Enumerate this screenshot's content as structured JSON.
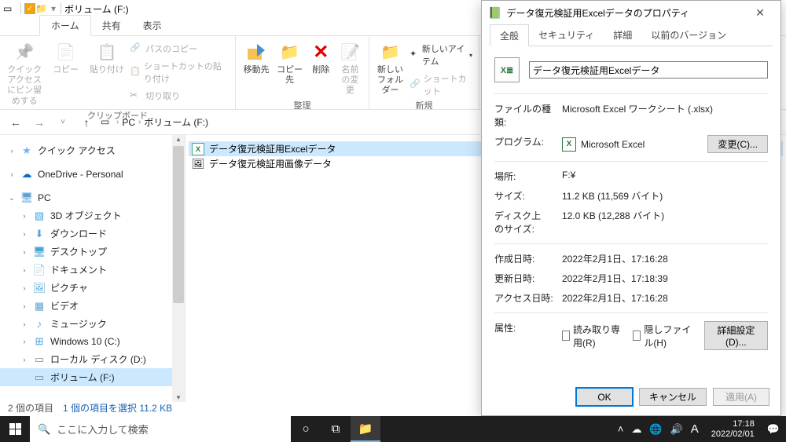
{
  "titlebar": {
    "title": "ボリューム (F:)"
  },
  "ribbon_tabs": {
    "home": "ホーム",
    "share": "共有",
    "view": "表示"
  },
  "ribbon": {
    "clipboard": {
      "pin": "クイック アクセス\nにピン留めする",
      "copy": "コピー",
      "paste": "貼り付け",
      "cut": "切り取り",
      "path": "パスのコピー",
      "shortcut": "ショートカットの貼り付け",
      "group": "クリップボード"
    },
    "organize": {
      "move": "移動先",
      "copyto": "コピー先",
      "delete": "削除",
      "rename": "名前\nの変更",
      "group": "整理"
    },
    "new": {
      "folder": "新しい\nフォルダー",
      "item": "新しいアイテム",
      "shortcut": "ショートカット",
      "group": "新規"
    }
  },
  "address": {
    "pc": "PC",
    "vol": "ボリューム (F:)"
  },
  "nav": {
    "quick": "クイック アクセス",
    "onedrive": "OneDrive - Personal",
    "pc": "PC",
    "objects3d": "3D オブジェクト",
    "downloads": "ダウンロード",
    "desktop": "デスクトップ",
    "documents": "ドキュメント",
    "pictures": "ピクチャ",
    "videos": "ビデオ",
    "music": "ミュージック",
    "cdrive": "Windows 10 (C:)",
    "ddrive": "ローカル ディスク (D:)",
    "fdrive": "ボリューム (F:)"
  },
  "files": {
    "f1": "データ復元検証用Excelデータ",
    "f2": "データ復元検証用画像データ"
  },
  "status": {
    "count": "2 個の項目",
    "sel": "1 個の項目を選択 11.2 KB"
  },
  "props": {
    "title": "データ復元検証用Excelデータのプロパティ",
    "tabs": {
      "general": "全般",
      "security": "セキュリティ",
      "details": "詳細",
      "prev": "以前のバージョン"
    },
    "filename": "データ復元検証用Excelデータ",
    "labels": {
      "type": "ファイルの種類:",
      "program": "プログラム:",
      "location": "場所:",
      "size": "サイズ:",
      "disksize": "ディスク上\nのサイズ:",
      "created": "作成日時:",
      "modified": "更新日時:",
      "accessed": "アクセス日時:",
      "attrs": "属性:"
    },
    "values": {
      "type": "Microsoft Excel ワークシート (.xlsx)",
      "program": "Microsoft Excel",
      "location": "F:¥",
      "size": "11.2 KB (11,569 バイト)",
      "disksize": "12.0 KB (12,288 バイト)",
      "created": "2022年2月1日、17:16:28",
      "modified": "2022年2月1日、17:18:39",
      "accessed": "2022年2月1日、17:16:28"
    },
    "change_btn": "変更(C)...",
    "readonly": "読み取り専用(R)",
    "hidden": "隠しファイル(H)",
    "advanced": "詳細設定(D)...",
    "ok": "OK",
    "cancel": "キャンセル",
    "apply": "適用(A)"
  },
  "taskbar": {
    "search_placeholder": "ここに入力して検索",
    "ime": "A",
    "time": "17:18",
    "date": "2022/02/01"
  }
}
